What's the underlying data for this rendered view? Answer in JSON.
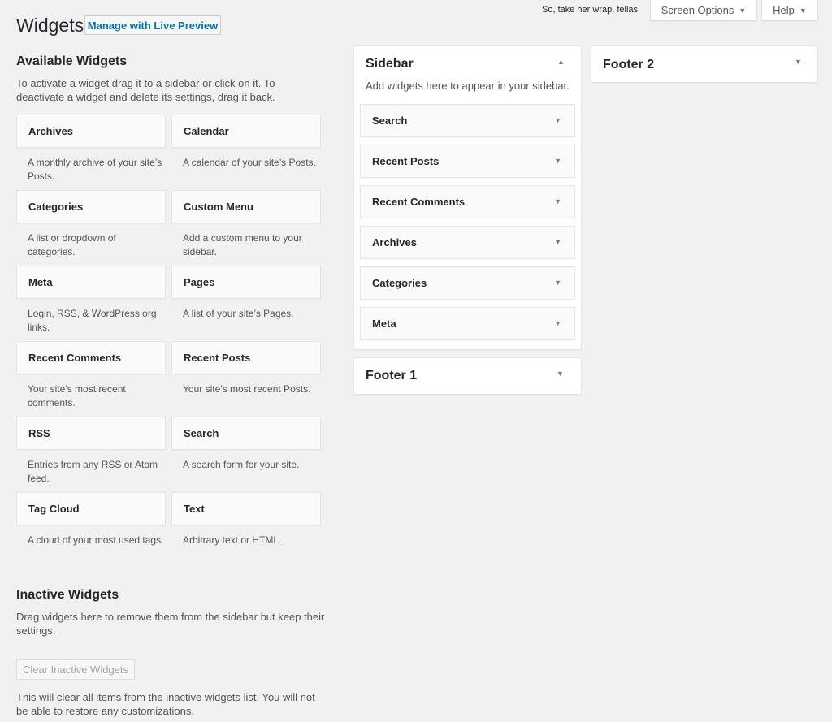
{
  "topbar": {
    "hello_text": "So, take her wrap, fellas",
    "screen_options_label": "Screen Options",
    "help_label": "Help"
  },
  "header": {
    "title": "Widgets",
    "live_preview_label": "Manage with Live Preview"
  },
  "available": {
    "title": "Available Widgets",
    "description": "To activate a widget drag it to a sidebar or click on it. To deactivate a widget and delete its settings, drag it back.",
    "widgets": [
      {
        "name": "Archives",
        "desc": "A monthly archive of your site’s Posts."
      },
      {
        "name": "Calendar",
        "desc": "A calendar of your site’s Posts."
      },
      {
        "name": "Categories",
        "desc": "A list or dropdown of categories."
      },
      {
        "name": "Custom Menu",
        "desc": "Add a custom menu to your sidebar."
      },
      {
        "name": "Meta",
        "desc": "Login, RSS, & WordPress.org links."
      },
      {
        "name": "Pages",
        "desc": "A list of your site’s Pages."
      },
      {
        "name": "Recent Comments",
        "desc": "Your site’s most recent comments."
      },
      {
        "name": "Recent Posts",
        "desc": "Your site’s most recent Posts."
      },
      {
        "name": "RSS",
        "desc": "Entries from any RSS or Atom feed."
      },
      {
        "name": "Search",
        "desc": "A search form for your site."
      },
      {
        "name": "Tag Cloud",
        "desc": "A cloud of your most used tags."
      },
      {
        "name": "Text",
        "desc": "Arbitrary text or HTML."
      }
    ]
  },
  "inactive": {
    "title": "Inactive Widgets",
    "description": "Drag widgets here to remove them from the sidebar but keep their settings.",
    "clear_label": "Clear Inactive Widgets",
    "clear_note": "This will clear all items from the inactive widgets list. You will not be able to restore any customizations."
  },
  "sidebar": {
    "title": "Sidebar",
    "description": "Add widgets here to appear in your sidebar.",
    "widgets": [
      "Search",
      "Recent Posts",
      "Recent Comments",
      "Archives",
      "Categories",
      "Meta"
    ]
  },
  "footer1": {
    "title": "Footer 1"
  },
  "footer2": {
    "title": "Footer 2"
  },
  "icons": {
    "caret_down": "▼",
    "caret_up": "▲"
  }
}
